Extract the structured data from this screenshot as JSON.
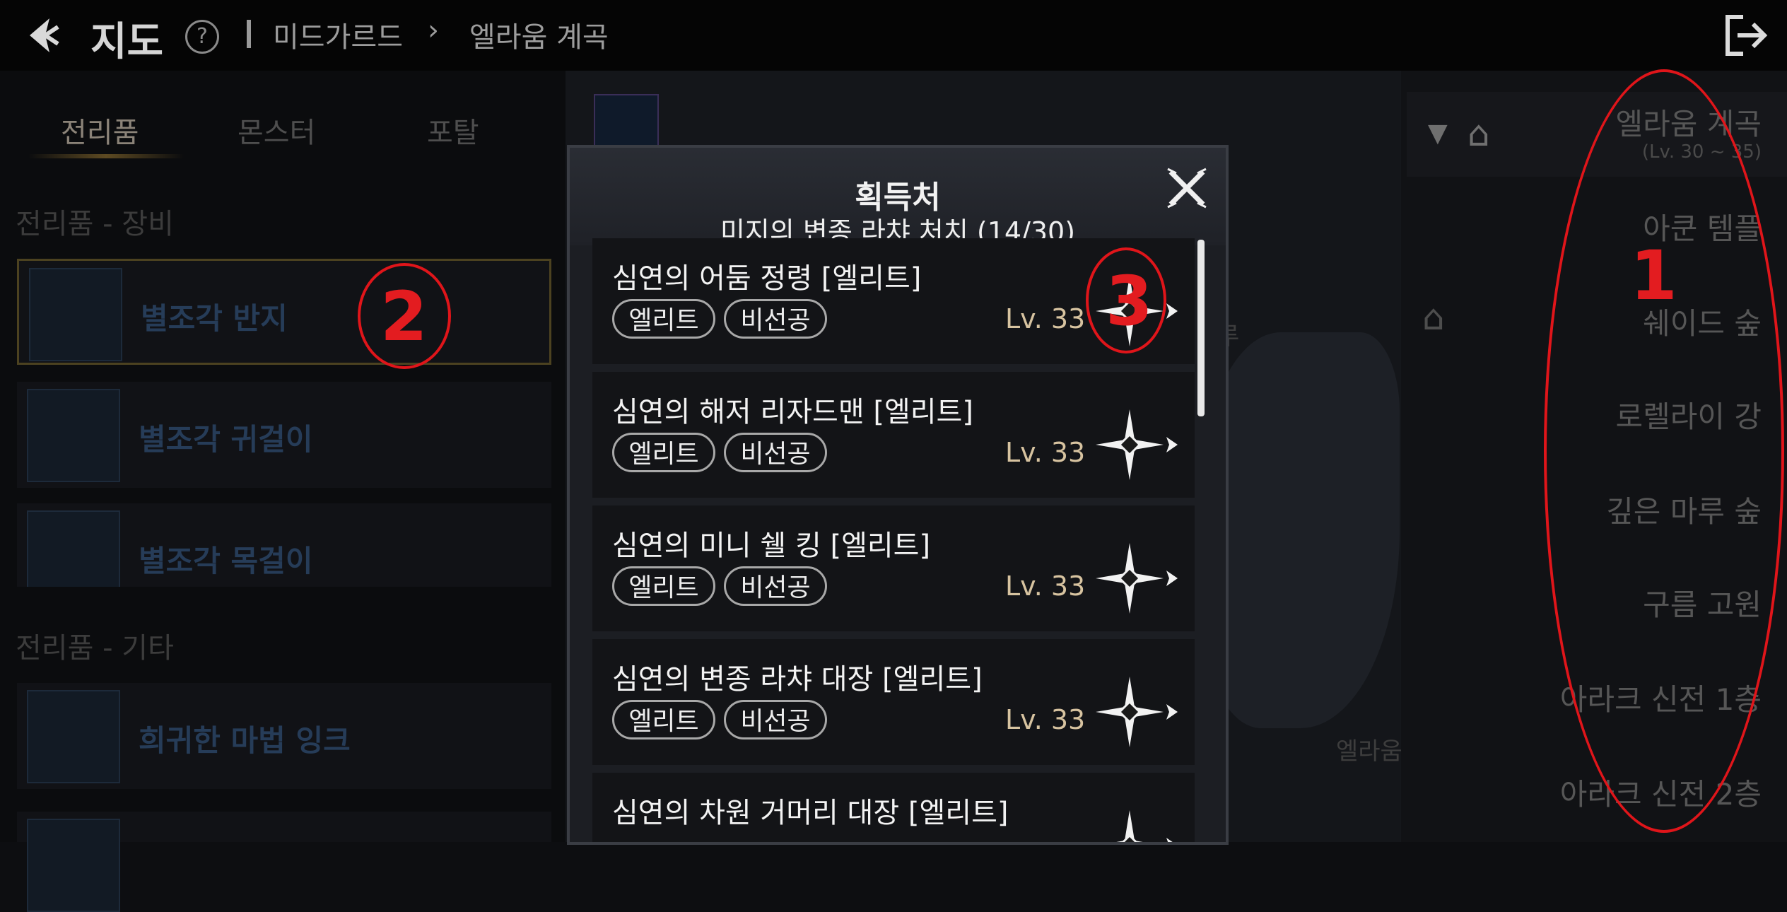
{
  "header": {
    "title": "지도",
    "breadcrumb": [
      "미드가르드",
      "엘라움 계곡"
    ],
    "breadcrumb_separator": "›",
    "help_label": "?"
  },
  "left_panel": {
    "tabs": [
      {
        "label": "전리품",
        "active": true
      },
      {
        "label": "몬스터",
        "active": false
      },
      {
        "label": "포탈",
        "active": false
      }
    ],
    "sections": [
      {
        "title": "전리품 - 장비",
        "items": [
          "별조각 반지",
          "별조각 귀걸이",
          "별조각 목걸이"
        ]
      },
      {
        "title": "전리품 - 기타",
        "items": [
          "희귀한 마법 잉크"
        ]
      }
    ]
  },
  "map": {
    "labels": [
      "엘라움 계곡 입구",
      "루"
    ]
  },
  "right_panel": {
    "current_zone": "엘라움 계곡",
    "current_level": "(Lv. 30 ~ 35)",
    "zones": [
      "아쿤 템플",
      "쉐이드 숲",
      "로렐라이 강",
      "깊은 마루 숲",
      "구름 고원",
      "아라크 신전 1층",
      "아라크 신전 2층"
    ]
  },
  "modal": {
    "title": "획득처",
    "subtitle": "미지의 변종 라챠 처치 (14/30)",
    "rows": [
      {
        "name": "심연의 어둠 정령 [엘리트]",
        "tags": [
          "엘리트",
          "비선공"
        ],
        "level": "Lv. 33"
      },
      {
        "name": "심연의 해저 리자드맨 [엘리트]",
        "tags": [
          "엘리트",
          "비선공"
        ],
        "level": "Lv. 33"
      },
      {
        "name": "심연의 미니 쉘 킹 [엘리트]",
        "tags": [
          "엘리트",
          "비선공"
        ],
        "level": "Lv. 33"
      },
      {
        "name": "심연의 변종 라챠 대장 [엘리트]",
        "tags": [
          "엘리트",
          "비선공"
        ],
        "level": "Lv. 33"
      },
      {
        "name": "심연의 차원 거머리 대장 [엘리트]",
        "tags": [],
        "level": ""
      }
    ]
  },
  "annotations": [
    "1",
    "2",
    "3"
  ],
  "colors": {
    "annotation": "#e31c20",
    "level_text": "#d7c3a0"
  }
}
